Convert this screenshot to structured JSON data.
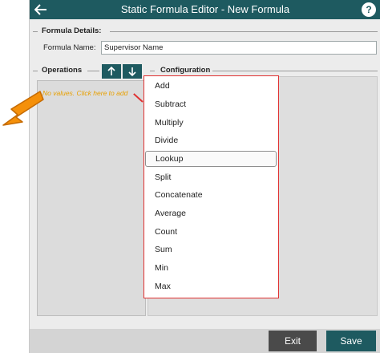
{
  "window": {
    "title": "Static Formula Editor - New Formula",
    "help_label": "?",
    "colors": {
      "titlebar": "#1e5a60",
      "accent": "#1e5a60",
      "annotation": "#e03030",
      "pointer": "#f5900a",
      "placeholder": "#e8a000"
    }
  },
  "formula_details": {
    "section_label": "Formula Details:",
    "name_label": "Formula Name:",
    "name_value": "Supervisor Name"
  },
  "operations": {
    "section_label": "Operations",
    "empty_text": "No values. Click here to add",
    "move_up_icon": "arrow-up-icon",
    "move_down_icon": "arrow-down-icon"
  },
  "configuration": {
    "section_label": "Configuration"
  },
  "menu": {
    "items": [
      "Add",
      "Subtract",
      "Multiply",
      "Divide",
      "Lookup",
      "Split",
      "Concatenate",
      "Average",
      "Count",
      "Sum",
      "Min",
      "Max"
    ],
    "highlighted": "Lookup"
  },
  "footer": {
    "exit_label": "Exit",
    "save_label": "Save"
  }
}
